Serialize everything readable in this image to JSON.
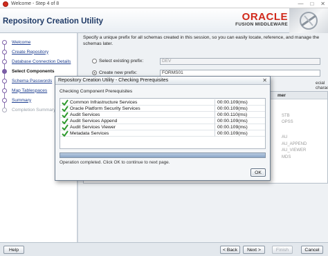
{
  "window": {
    "title": "Welcome - Step 4 of 8",
    "controls": [
      "—",
      "□",
      "✕"
    ]
  },
  "header": {
    "app_title": "Repository Creation Utility",
    "brand_oracle": "ORACLE",
    "brand_fusion": "FUSION MIDDLEWARE"
  },
  "sidebar": {
    "steps": [
      {
        "label": "Welcome",
        "state": "done"
      },
      {
        "label": "Create Repository",
        "state": "done"
      },
      {
        "label": "Database Connection Details",
        "state": "done"
      },
      {
        "label": "Select Components",
        "state": "current"
      },
      {
        "label": "Schema Passwords",
        "state": "link"
      },
      {
        "label": "Map Tablespaces",
        "state": "link"
      },
      {
        "label": "Summary",
        "state": "link"
      },
      {
        "label": "Completion Summary",
        "state": "future"
      }
    ]
  },
  "main": {
    "description": "Specify a unique prefix for all schemas created in this session, so you can easily locate, reference, and manage the schemas later.",
    "select_existing_label": "Select existing prefix:",
    "select_existing_value": "DEV",
    "create_new_label": "Create new prefix:",
    "create_new_value": "FORMS01",
    "side_note": "ecial characters.",
    "table_header": "mer",
    "table_cells": [
      "STB",
      "OPSS",
      "AU",
      "AU_APPEND",
      "AU_VIEWER",
      "MDS"
    ]
  },
  "dialog": {
    "title": "Repository Creation Utility - Checking Prerequisites",
    "close": "✕",
    "heading": "Checking Component Prerequisites",
    "rows": [
      {
        "name": "Common Infrastructure Services",
        "time": "00:00.109(ms)"
      },
      {
        "name": "Oracle Platform Security Services",
        "time": "00:00.109(ms)"
      },
      {
        "name": "Audit Services",
        "time": "00:00.110(ms)"
      },
      {
        "name": "Audit Services Append",
        "time": "00:00.109(ms)"
      },
      {
        "name": "Audit Services Viewer",
        "time": "00:00.109(ms)"
      },
      {
        "name": "Metadata Services",
        "time": "00:00.109(ms)"
      }
    ],
    "progress_percent": 100,
    "status": "Operation completed. Click OK to continue to next page.",
    "ok_label": "OK"
  },
  "footer": {
    "help_label": "Help",
    "back_label": "< Back",
    "next_label": "Next >",
    "finish_label": "Finish",
    "cancel_label": "Cancel"
  },
  "colors": {
    "accent_red": "#d1291b",
    "title_blue": "#1f3a66",
    "check_green": "#2e9a2e",
    "step_purple": "#7b5ea6"
  }
}
